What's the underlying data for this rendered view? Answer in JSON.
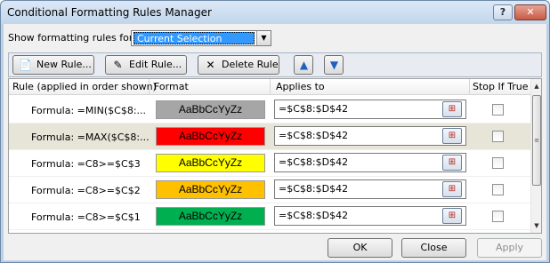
{
  "window": {
    "title": "Conditional Formatting Rules Manager",
    "help_glyph": "?",
    "close_glyph": "✕"
  },
  "show_rules": {
    "label": "Show formatting rules for:",
    "selected": "Current Selection"
  },
  "toolbar": {
    "new_rule": "New Rule...",
    "edit_rule": "Edit Rule...",
    "delete_rule": "Delete Rule",
    "move_up_icon": "up-arrow-icon",
    "move_down_icon": "down-arrow-icon"
  },
  "table": {
    "headers": {
      "rule": "Rule (applied in order shown)",
      "format": "Format",
      "applies_to": "Applies to",
      "stop": "Stop If True"
    },
    "rows": [
      {
        "rule": "Formula: =MIN($C$8:...",
        "preview": "AaBbCcYyZz",
        "fill": "#a6a6a6",
        "applies": "=$C$8:$D$42",
        "stop_if_true": false,
        "selected": false
      },
      {
        "rule": "Formula: =MAX($C$8:...",
        "preview": "AaBbCcYyZz",
        "fill": "#ff0000",
        "applies": "=$C$8:$D$42",
        "stop_if_true": false,
        "selected": true
      },
      {
        "rule": "Formula: =C8>=$C$3",
        "preview": "AaBbCcYyZz",
        "fill": "#ffff00",
        "applies": "=$C$8:$D$42",
        "stop_if_true": false,
        "selected": false
      },
      {
        "rule": "Formula: =C8>=$C$2",
        "preview": "AaBbCcYyZz",
        "fill": "#ffc000",
        "applies": "=$C$8:$D$42",
        "stop_if_true": false,
        "selected": false
      },
      {
        "rule": "Formula: =C8>=$C$1",
        "preview": "AaBbCcYyZz",
        "fill": "#00b050",
        "applies": "=$C$8:$D$42",
        "stop_if_true": false,
        "selected": false
      }
    ]
  },
  "buttons": {
    "ok": "OK",
    "close": "Close",
    "apply": "Apply"
  }
}
